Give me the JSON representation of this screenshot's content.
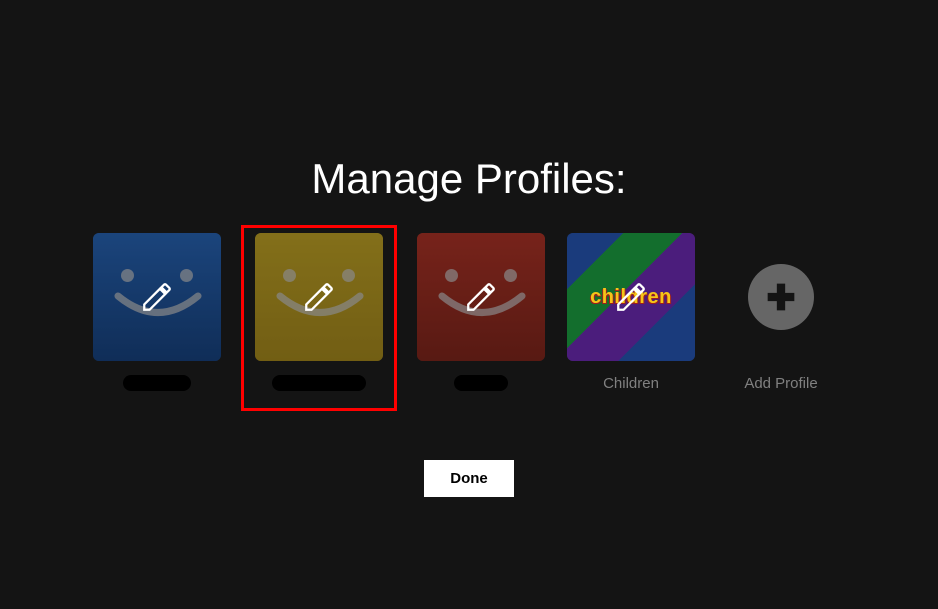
{
  "title": "Manage Profiles:",
  "profiles": {
    "0": {
      "label": ""
    },
    "1": {
      "label": ""
    },
    "2": {
      "label": ""
    },
    "3": {
      "label": "Children",
      "avatar_text": "children"
    }
  },
  "add_profile_label": "Add Profile",
  "done_label": "Done",
  "icons": {
    "pencil": "pencil-icon",
    "plus": "plus-icon"
  },
  "highlighted_index": 1
}
